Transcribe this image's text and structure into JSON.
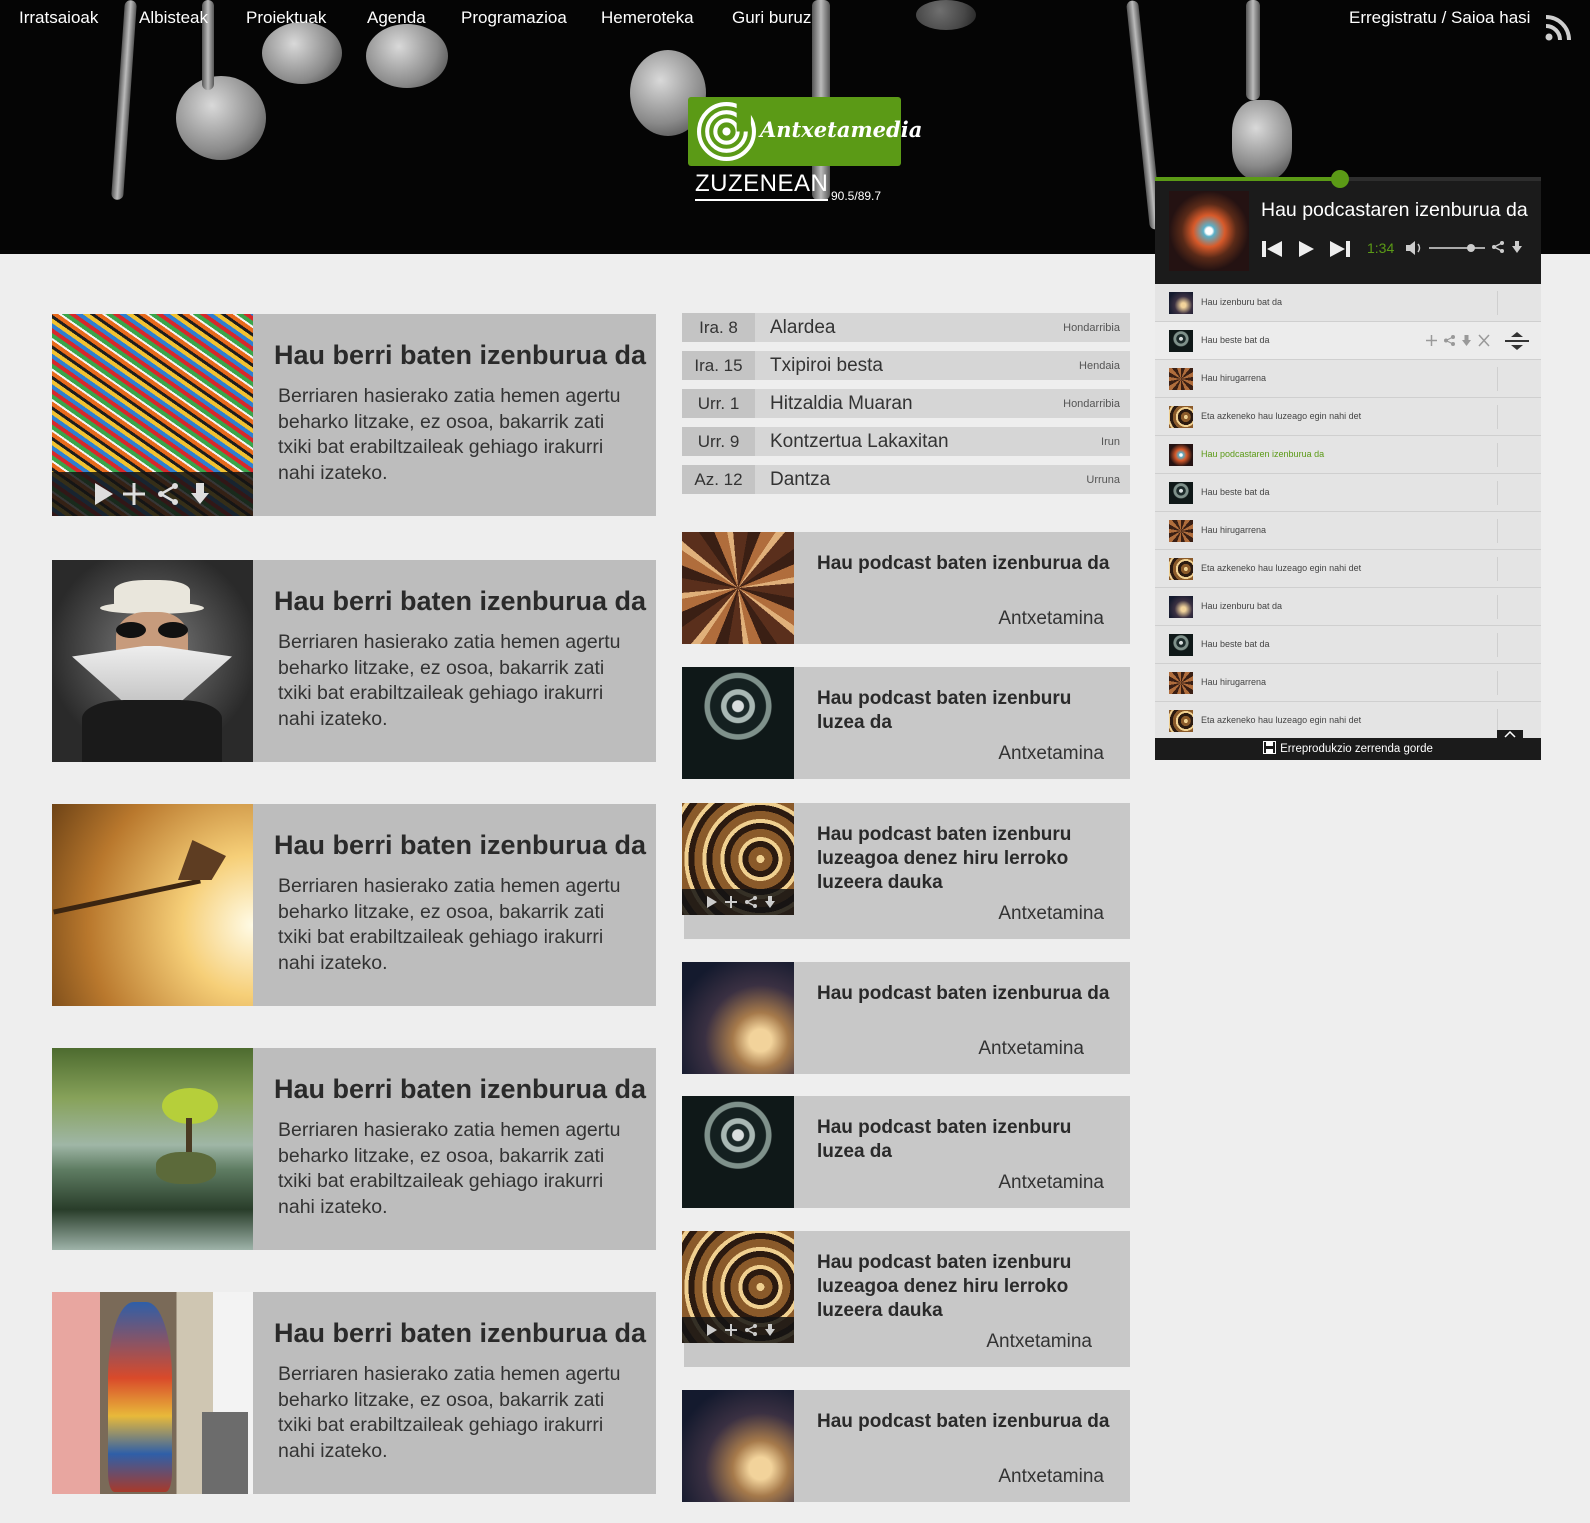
{
  "nav": {
    "items": [
      "Irratsaioak",
      "Albisteak",
      "Proiektuak",
      "Agenda",
      "Programazioa",
      "Hemeroteka",
      "Guri buruz"
    ],
    "login": "Erregistratu / Saioa hasi",
    "rss_icon": "rss-icon"
  },
  "brand": {
    "logo_text": "Antxetamedia",
    "live_label": "ZUZENEAN",
    "frequency": "90.5/89.7",
    "accent_color": "#5b9a16"
  },
  "news": [
    {
      "title": "Hau berri baten izenburua da",
      "text": "Berriaren hasierako zatia hemen agertu beharko litzake, ez osoa, bakarrik zati txiki bat erabiltzaileak gehiago  irakurri nahi izateko."
    },
    {
      "title": "Hau berri baten izenburua da",
      "text": "Berriaren hasierako zatia hemen agertu beharko litzake, ez osoa, bakarrik zati txiki bat erabiltzaileak gehiago  irakurri nahi izateko."
    },
    {
      "title": "Hau berri baten izenburua da",
      "text": "Berriaren hasierako zatia hemen agertu beharko litzake, ez osoa, bakarrik zati txiki bat erabiltzaileak gehiago  irakurri nahi izateko."
    },
    {
      "title": "Hau berri baten izenburua da",
      "text": "Berriaren hasierako zatia hemen agertu beharko litzake, ez osoa, bakarrik zati txiki bat erabiltzaileak gehiago  irakurri nahi izateko."
    },
    {
      "title": "Hau berri baten izenburua da",
      "text": "Berriaren hasierako zatia hemen agertu beharko litzake, ez osoa, bakarrik zati txiki bat erabiltzaileak gehiago  irakurri nahi izateko."
    }
  ],
  "agenda": [
    {
      "date": "Ira. 8",
      "name": "Alardea",
      "place": "Hondarribia"
    },
    {
      "date": "Ira. 15",
      "name": "Txipiroi besta",
      "place": "Hendaia"
    },
    {
      "date": "Urr. 1",
      "name": "Hitzaldia Muaran",
      "place": "Hondarribia"
    },
    {
      "date": "Urr. 9",
      "name": "Kontzertua Lakaxitan",
      "place": "Irun"
    },
    {
      "date": "Az. 12",
      "name": "Dantza",
      "place": "Urruna"
    }
  ],
  "podcasts": [
    {
      "title": "Hau podcast baten  izenburua da",
      "author": "Antxetamina"
    },
    {
      "title": "Hau podcast baten  izenburu luzea da",
      "author": "Antxetamina"
    },
    {
      "title": "Hau podcast baten  izenburu luzeagoa denez hiru lerroko luzeera dauka",
      "author": "Antxetamina"
    },
    {
      "title": "Hau podcast baten  izenburua da",
      "author": "Antxetamina"
    },
    {
      "title": "Hau podcast baten  izenburu luzea da",
      "author": "Antxetamina"
    },
    {
      "title": "Hau podcast baten  izenburu luzeagoa denez hiru lerroko luzeera dauka",
      "author": "Antxetamina"
    },
    {
      "title": "Hau podcast baten  izenburua da",
      "author": "Antxetamina"
    }
  ],
  "player": {
    "title": "Hau podcastaren izenburua da",
    "time": "1:34",
    "progress": 0.48,
    "volume": 0.75
  },
  "playlist": {
    "items": [
      "Hau izenburu bat da",
      "Hau beste bat da",
      "Hau hirugarrena",
      "Eta azkeneko hau luzeago egin nahi det",
      "Hau podcastaren izenburua da",
      "Hau beste bat da",
      "Hau hirugarrena",
      "Eta azkeneko hau luzeago egin nahi det",
      "Hau izenburu bat da",
      "Hau beste bat da",
      "Hau hirugarrena",
      "Eta azkeneko hau luzeago egin nahi det"
    ],
    "active_index": 4,
    "save_label": "Erreprodukzio zerrenda gorde"
  }
}
